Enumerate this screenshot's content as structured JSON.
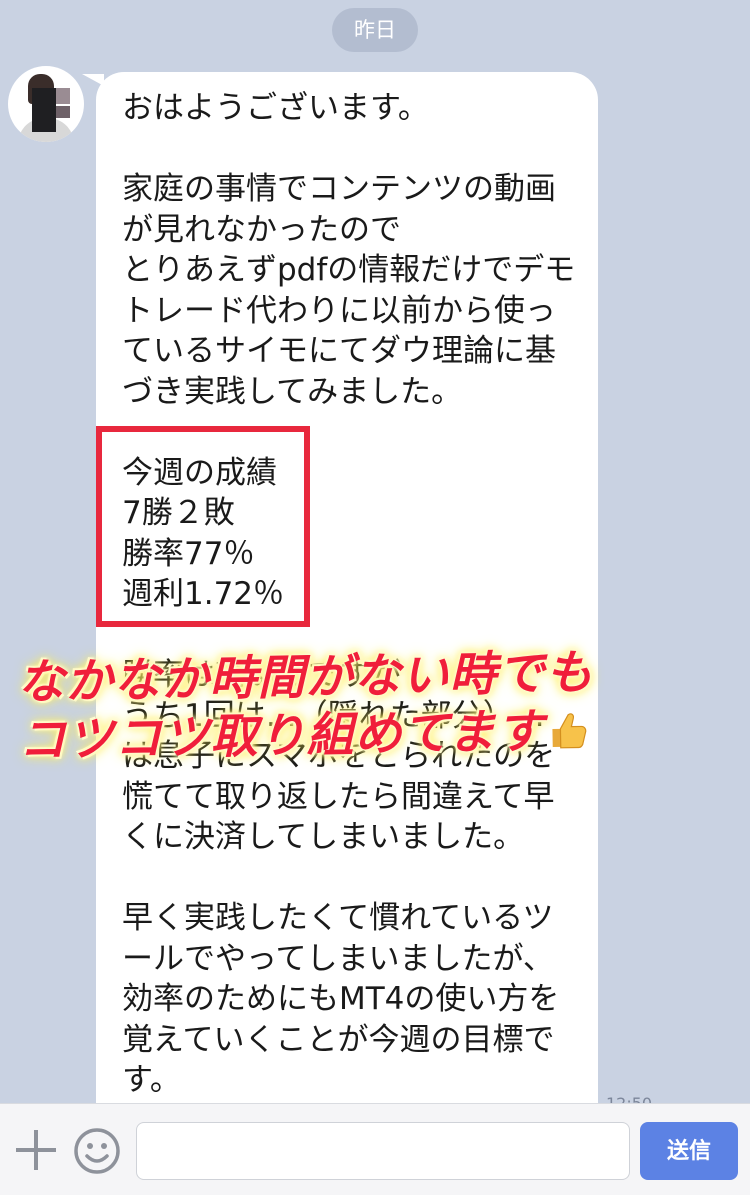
{
  "date_label": "昨日",
  "message": {
    "text": "おはようございます。\n\n家庭の事情でコンテンツの動画が見れなかったので\nとりあえずpdfの情報だけでデモトレード代わりに以前から使っているサイモにてダウ理論に基づき実践してみました。\n\n今週の成績\n7勝２敗\n勝率77％\n週利1.72％\n\n勝率は高いのですが\nうち1回は…（隠れた部分）…\nは息子にスマホをとられたのを慌てて取り返したら間違えて早くに決済してしまいました。\n\n早く実践したくて慣れているツールでやってしまいましたが、効率のためにもMT4の使い方を覚えていくことが今週の目標です。",
    "time": "12:50"
  },
  "overlay": {
    "line1": "なかなか時間がない時でも",
    "line2": "コツコツ取り組めてます",
    "emoji": "thumbs-up-icon",
    "color": "#f01e3a",
    "glow": "#fff35c"
  },
  "input_bar": {
    "placeholder": "",
    "send_label": "送信",
    "accent": "#5c82e4"
  }
}
